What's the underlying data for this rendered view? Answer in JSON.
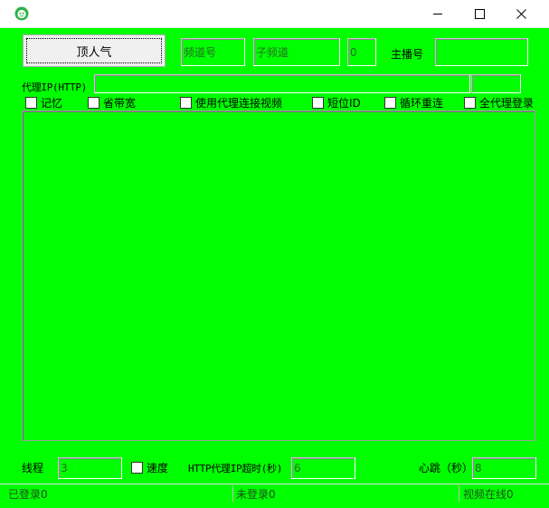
{
  "window": {
    "minimize": "—",
    "maximize": "☐",
    "close": "✕"
  },
  "toolbar": {
    "boost_button": "顶人气",
    "channel_placeholder": "频道号",
    "subchannel_placeholder": "子频道",
    "count_value": "0",
    "anchor_label": "主播号",
    "anchor_value": ""
  },
  "proxy": {
    "label": "代理IP(HTTP)",
    "value": "",
    "extra_value": ""
  },
  "options": [
    {
      "label": "记忆"
    },
    {
      "label": "省带宽"
    },
    {
      "label": "使用代理连接视频"
    },
    {
      "label": "短位ID"
    },
    {
      "label": "循环重连"
    },
    {
      "label": "全代理登录"
    }
  ],
  "bottom": {
    "threads_label": "线程",
    "threads_value": "3",
    "speed_label": "速度",
    "timeout_label": "HTTP代理IP超时(秒)",
    "timeout_value": "6",
    "heartbeat_label": "心跳（秒）",
    "heartbeat_value": "8"
  },
  "status": {
    "logged_in": "已登录0",
    "not_logged_in": "未登录0",
    "video_online": "视频在线0"
  }
}
